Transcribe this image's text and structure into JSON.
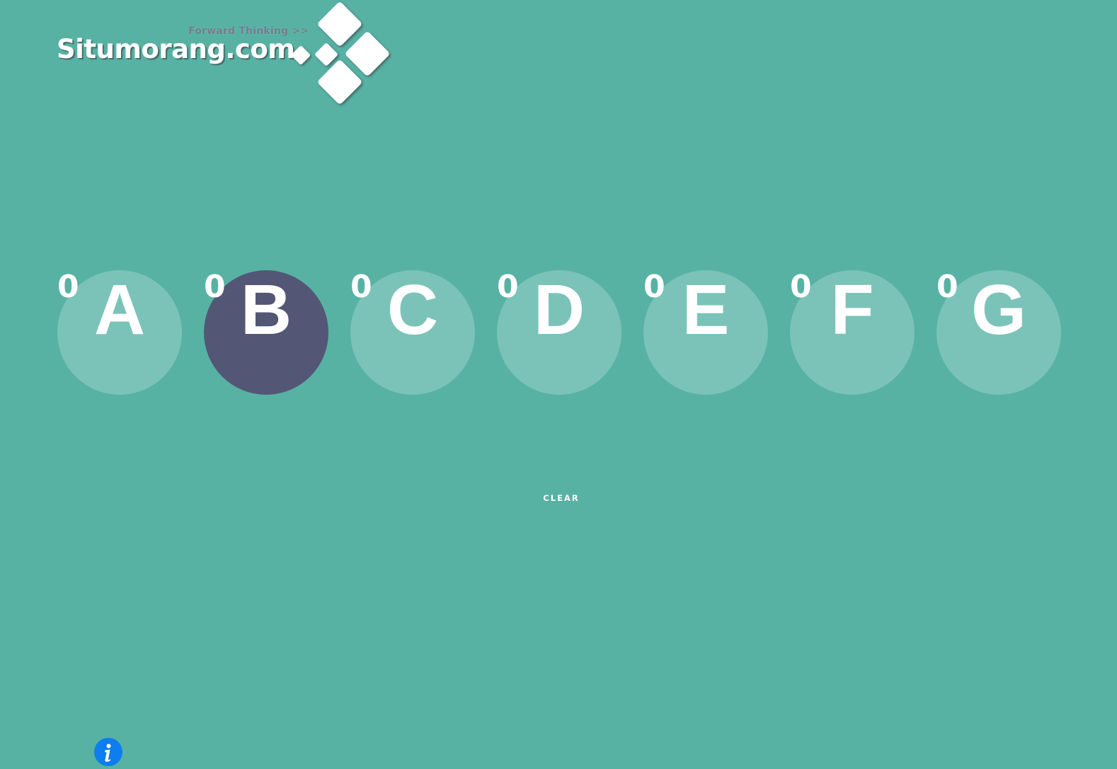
{
  "brand": {
    "name": "Situmorang.com",
    "tagline": "Forward Thinking >>",
    "logo_icon": "diamond-tiles-icon"
  },
  "letters": [
    {
      "label": "A",
      "count": "0",
      "active": false
    },
    {
      "label": "B",
      "count": "0",
      "active": true
    },
    {
      "label": "C",
      "count": "0",
      "active": false
    },
    {
      "label": "D",
      "count": "0",
      "active": false
    },
    {
      "label": "E",
      "count": "0",
      "active": false
    },
    {
      "label": "F",
      "count": "0",
      "active": false
    },
    {
      "label": "G",
      "count": "0",
      "active": false
    }
  ],
  "controls": {
    "clear_label": "CLEAR",
    "info_icon": "info-icon"
  },
  "colors": {
    "background": "#57b2a4",
    "active_circle": "#535775",
    "inactive_circle": "rgba(255,255,255,0.22)",
    "info_button": "#0d7df0"
  }
}
